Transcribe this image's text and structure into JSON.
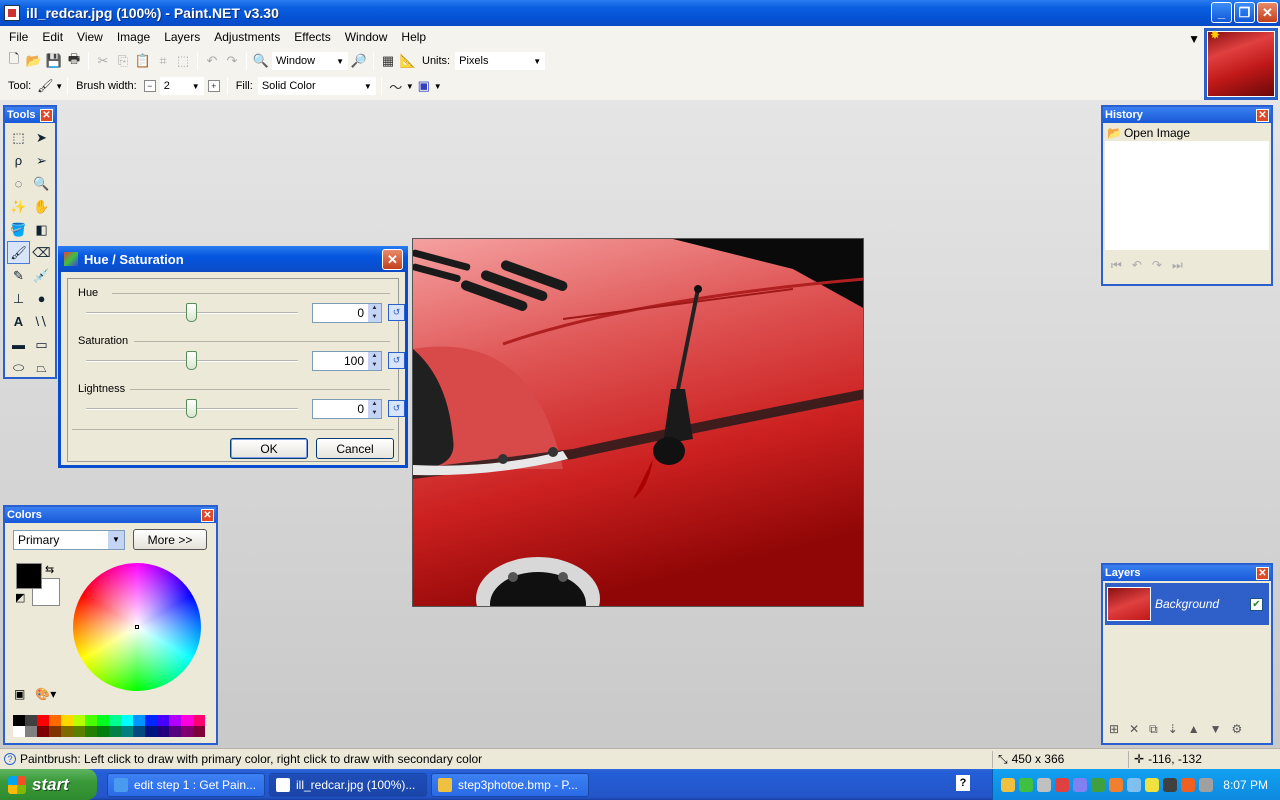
{
  "window": {
    "title": "ill_redcar.jpg (100%) - Paint.NET v3.30"
  },
  "menu": [
    "File",
    "Edit",
    "View",
    "Image",
    "Layers",
    "Adjustments",
    "Effects",
    "Window",
    "Help"
  ],
  "toolbar1": {
    "zoom_value": "Window",
    "units_label": "Units:",
    "units_value": "Pixels"
  },
  "toolbar2": {
    "tool_label": "Tool:",
    "brush_width_label": "Brush width:",
    "brush_width_value": "2",
    "fill_label": "Fill:",
    "fill_value": "Solid Color"
  },
  "panels": {
    "tools_title": "Tools",
    "history_title": "History",
    "history_items": [
      "Open Image"
    ],
    "colors_title": "Colors",
    "colors_select": "Primary",
    "colors_more": "More >>",
    "layers_title": "Layers",
    "layers_items": [
      "Background"
    ]
  },
  "dialog": {
    "title": "Hue / Saturation",
    "hue_label": "Hue",
    "hue_value": "0",
    "saturation_label": "Saturation",
    "saturation_value": "100",
    "lightness_label": "Lightness",
    "lightness_value": "0",
    "ok": "OK",
    "cancel": "Cancel"
  },
  "status": {
    "message": "Paintbrush: Left click to draw with primary color, right click to draw with secondary color",
    "image_size": "450 x 366",
    "cursor_pos": "-116, -132"
  },
  "taskbar": {
    "start": "start",
    "items": [
      "edit step 1 : Get Pain...",
      "ill_redcar.jpg (100%)...",
      "step3photoe.bmp - P..."
    ],
    "clock": "8:07 PM"
  },
  "palette": [
    "#000000",
    "#404040",
    "#ff0000",
    "#ff6a00",
    "#ffd800",
    "#b6ff00",
    "#4cff00",
    "#00ff21",
    "#00ff90",
    "#00ffff",
    "#0094ff",
    "#0026ff",
    "#4800ff",
    "#b200ff",
    "#ff00dc",
    "#ff006e",
    "#ffffff",
    "#808080",
    "#7f0000",
    "#7f3300",
    "#7f6a00",
    "#5b7f00",
    "#267f00",
    "#007f0e",
    "#007f46",
    "#007f7f",
    "#004a7f",
    "#00137f",
    "#21007f",
    "#57007f",
    "#7f006e",
    "#7f0037"
  ],
  "colors": {
    "primary": "#000000",
    "secondary": "#ffffff",
    "accent": "#2a5fd0"
  }
}
